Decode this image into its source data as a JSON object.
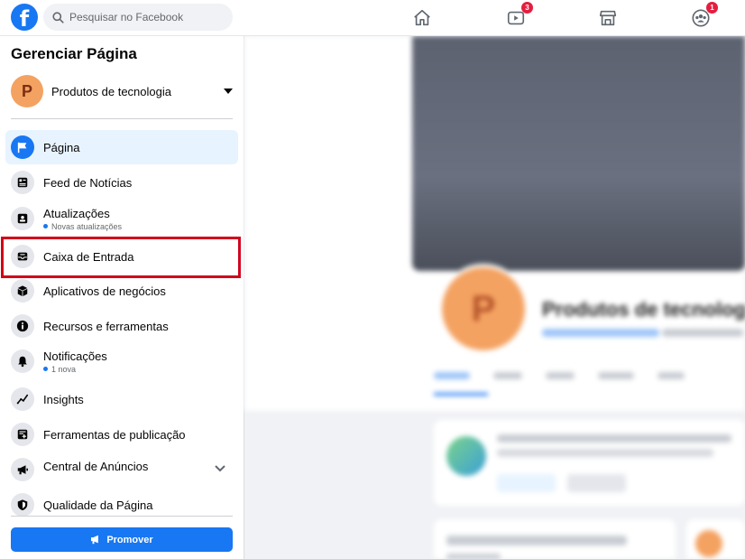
{
  "app": {
    "logo_letter": "f"
  },
  "search": {
    "placeholder": "Pesquisar no Facebook"
  },
  "nav": {
    "home_icon": "home-icon",
    "watch_badge": "3",
    "marketplace_icon": "store-icon",
    "groups_badge": "1"
  },
  "sidebar": {
    "title": "Gerenciar Página",
    "page": {
      "avatar_letter": "P",
      "name": "Produtos de tecnologia"
    },
    "items": [
      {
        "label": "Página",
        "icon": "flag-icon",
        "sub": ""
      },
      {
        "label": "Feed de Notícias",
        "icon": "news-feed-icon",
        "sub": ""
      },
      {
        "label": "Atualizações",
        "icon": "updates-icon",
        "sub": "Novas atualizações"
      },
      {
        "label": "Caixa de Entrada",
        "icon": "inbox-icon",
        "sub": ""
      },
      {
        "label": "Aplicativos de negócios",
        "icon": "cube-icon",
        "sub": ""
      },
      {
        "label": "Recursos e ferramentas",
        "icon": "info-icon",
        "sub": ""
      },
      {
        "label": "Notificações",
        "icon": "bell-icon",
        "sub": "1 nova"
      },
      {
        "label": "Insights",
        "icon": "insights-icon",
        "sub": ""
      },
      {
        "label": "Ferramentas de publicação",
        "icon": "publishing-tools-icon",
        "sub": ""
      },
      {
        "label": "Central de Anúncios",
        "icon": "megaphone-icon",
        "sub": ""
      },
      {
        "label": "Qualidade da Página",
        "icon": "shield-icon",
        "sub": ""
      }
    ],
    "promote_label": "Promover"
  },
  "main": {
    "avatar_letter": "P",
    "page_name": "Produtos de tecnologia"
  },
  "colors": {
    "accent": "#1877f2",
    "highlight": "#d0021b",
    "badge": "#e41e3f"
  }
}
